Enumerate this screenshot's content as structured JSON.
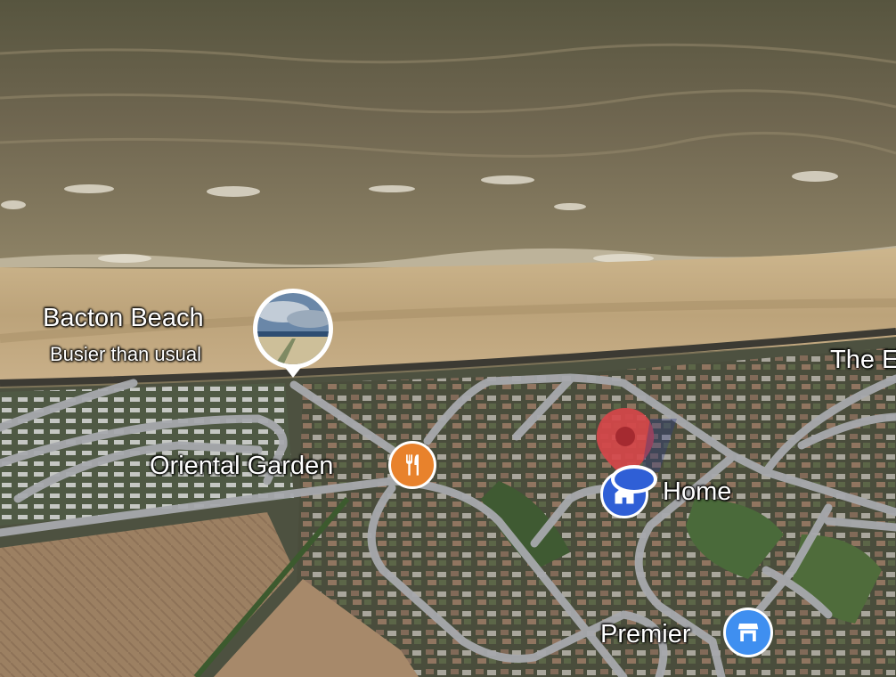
{
  "places": [
    {
      "name": "Bacton Beach",
      "subtitle": "Busier than usual",
      "icon": "photo-thumbnail-icon"
    },
    {
      "name": "Oriental Garden",
      "icon": "restaurant-icon",
      "color": "#e8822c"
    },
    {
      "name": "Home",
      "icon": "home-icon",
      "color": "#2f5fd6"
    },
    {
      "name": "Premier",
      "icon": "shop-icon",
      "color": "#3f8ff0"
    },
    {
      "name": "The E"
    }
  ],
  "colors": {
    "sea": "#7b7155",
    "sand": "#cbb48a",
    "road": "#a9abb0",
    "dropped_pin": "#d6474a"
  }
}
